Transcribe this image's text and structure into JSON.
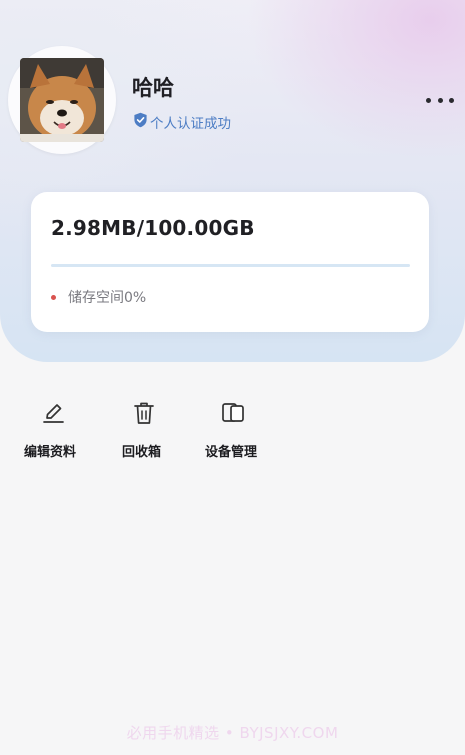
{
  "profile": {
    "name": "哈哈",
    "verification": "个人认证成功"
  },
  "storage": {
    "usage": "2.98MB/100.00GB",
    "legend": "储存空间0%",
    "percent": 0
  },
  "actions": [
    {
      "label": "编辑资料",
      "icon": "edit-icon"
    },
    {
      "label": "回收箱",
      "icon": "trash-icon"
    },
    {
      "label": "设备管理",
      "icon": "devices-icon"
    }
  ],
  "watermark": "必用手机精选 • BYJSJXY.COM",
  "colors": {
    "accent": "#4d7dc4",
    "legend_dot": "#d9534f",
    "progress": "#6fa4e0"
  }
}
